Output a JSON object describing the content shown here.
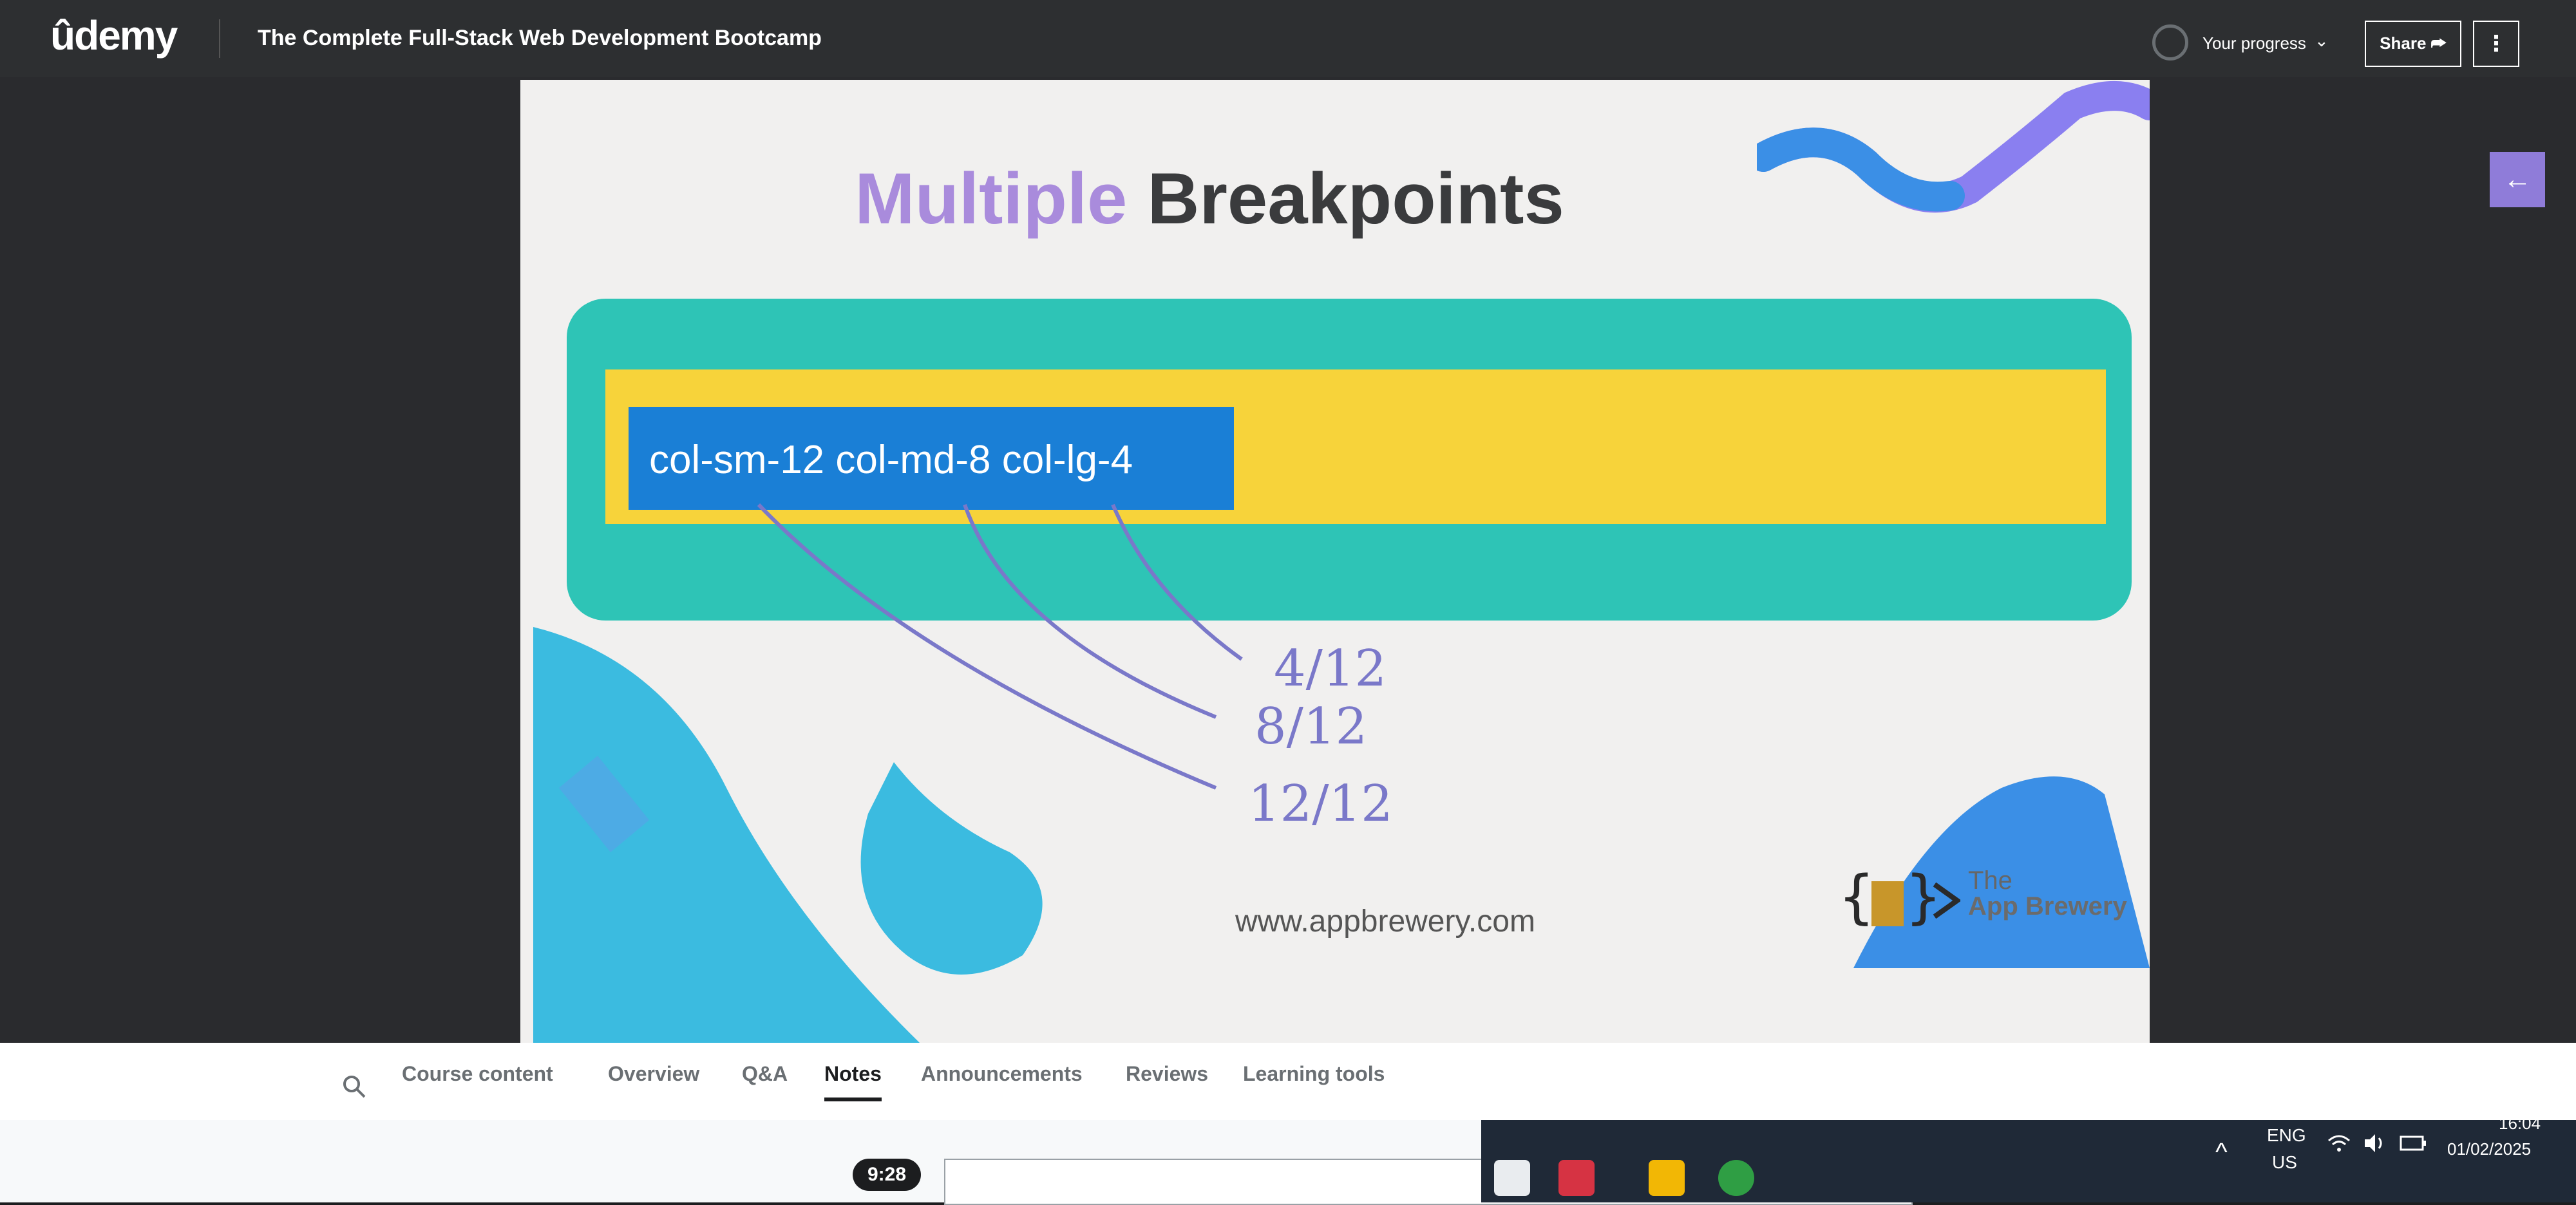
{
  "header": {
    "logo": "ûdemy",
    "course_title": "The Complete Full-Stack Web Development Bootcamp",
    "progress_label": "Your progress",
    "share_label": "Share ⮫",
    "more_label": "⋮"
  },
  "slide": {
    "title_accent": "Multiple",
    "title_rest": " Breakpoints",
    "class_text": "col-sm-12 col-md-8 col-lg-4",
    "annotations": [
      "4/12",
      "8/12",
      "12/12"
    ],
    "url": "www.appbrewery.com",
    "brand_the": "The",
    "brand_name": "App Brewery"
  },
  "tabs": [
    "Course content",
    "Overview",
    "Q&A",
    "Notes",
    "Announcements",
    "Reviews",
    "Learning tools"
  ],
  "active_tab": "Notes",
  "notes": {
    "timestamp": "9:28"
  },
  "taskbar": {
    "lang_top": "ENG",
    "lang_bottom": "US",
    "time": "16:04",
    "date": "01/02/2025"
  },
  "colors": {
    "header_bg": "#2d2f31",
    "teal": "#2ec4b6",
    "yellow": "#f7d33a",
    "blue": "#1a7fd6",
    "purple_accent": "#a98bdc",
    "back_button": "#8f7cd9"
  },
  "icons": [
    "search-icon",
    "arrow-left-icon",
    "chevron-down-icon",
    "wifi-icon",
    "volume-icon",
    "battery-icon"
  ]
}
